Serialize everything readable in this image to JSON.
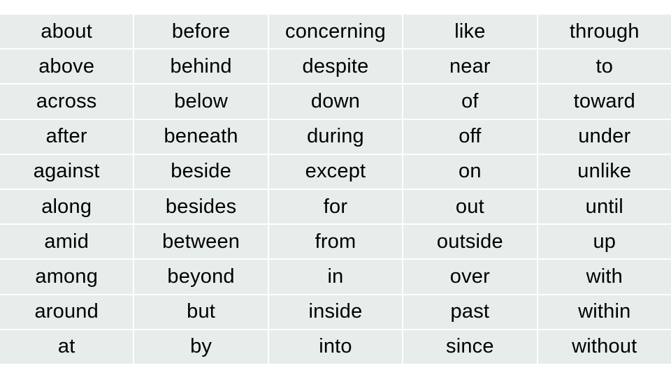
{
  "table": {
    "columns": [
      [
        "about",
        "above",
        "across",
        "after",
        "against",
        "along",
        "amid",
        "among",
        "around",
        "at"
      ],
      [
        "before",
        "behind",
        "below",
        "beneath",
        "beside",
        "besides",
        "between",
        "beyond",
        "but",
        "by"
      ],
      [
        "concerning",
        "despite",
        "down",
        "during",
        "except",
        "for",
        "from",
        "in",
        "inside",
        "into"
      ],
      [
        "like",
        "near",
        "of",
        "off",
        "on",
        "out",
        "outside",
        "over",
        "past",
        "since"
      ],
      [
        "through",
        "to",
        "toward",
        "under",
        "unlike",
        "until",
        "up",
        "with",
        "within",
        "without"
      ]
    ]
  },
  "colors": {
    "cell_background": "#e7edeb",
    "grid_lines": "#ffffff",
    "text": "#000000"
  }
}
